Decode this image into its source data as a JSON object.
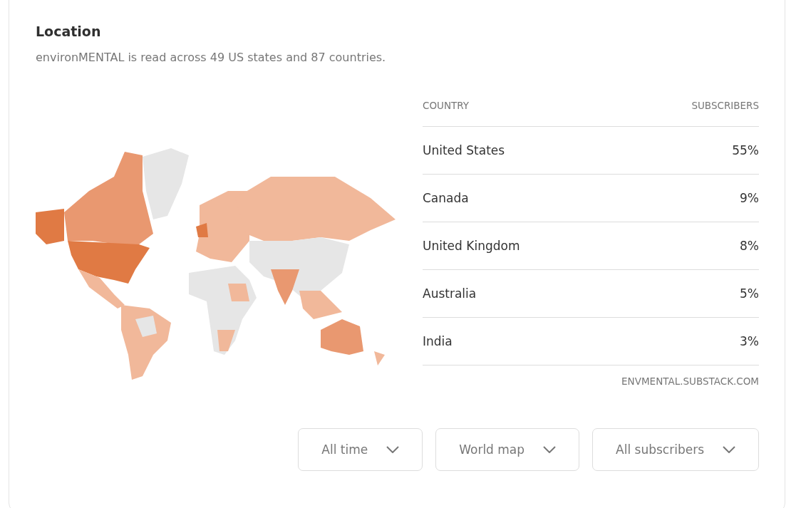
{
  "title": "Location",
  "subtitle": "environMENTAL is read across 49 US states and 87 countries.",
  "table": {
    "columns": [
      "COUNTRY",
      "SUBSCRIBERS"
    ],
    "rows": [
      {
        "country": "United States",
        "share": "55%"
      },
      {
        "country": "Canada",
        "share": "9%"
      },
      {
        "country": "United Kingdom",
        "share": "8%"
      },
      {
        "country": "Australia",
        "share": "5%"
      },
      {
        "country": "India",
        "share": "3%"
      }
    ],
    "source": "ENVMENTAL.SUBSTACK.COM"
  },
  "filters": [
    {
      "label": "All time"
    },
    {
      "label": "World map"
    },
    {
      "label": "All subscribers"
    }
  ]
}
